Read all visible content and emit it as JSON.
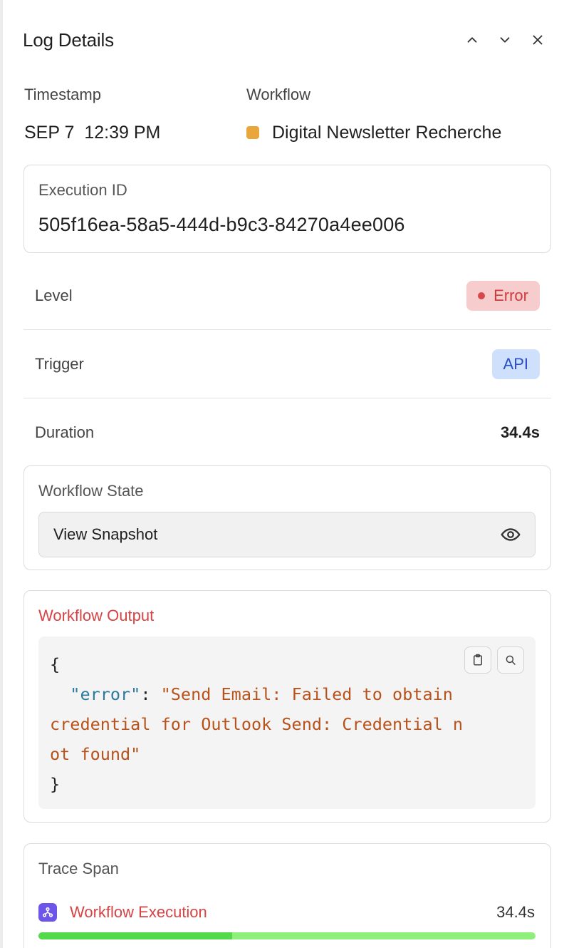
{
  "panel": {
    "title": "Log Details"
  },
  "meta": {
    "timestamp_label": "Timestamp",
    "timestamp_value": "SEP 7  12:39 PM",
    "workflow_label": "Workflow",
    "workflow_value": "Digital Newsletter Recherche",
    "workflow_color": "#e9a63b"
  },
  "execution": {
    "label": "Execution ID",
    "id": "505f16ea-58a5-444d-b9c3-84270a4ee006"
  },
  "level": {
    "label": "Level",
    "value": "Error"
  },
  "trigger": {
    "label": "Trigger",
    "value": "API"
  },
  "duration": {
    "label": "Duration",
    "value": "34.4s"
  },
  "workflow_state": {
    "label": "Workflow State",
    "button_label": "View Snapshot"
  },
  "output": {
    "label": "Workflow Output",
    "open_brace": "{",
    "key": "\"error\"",
    "colon": ": ",
    "value_line1": "\"Send Email: Failed to obtain",
    "value_line2": "credential for Outlook Send: Credential n",
    "value_line3": "ot found\"",
    "close_brace": "}"
  },
  "trace": {
    "label": "Trace Span",
    "span_name": "Workflow Execution",
    "span_duration": "34.4s",
    "progress": 0.39
  },
  "colors": {
    "error": "#d84343",
    "api": "#2a4fc4",
    "accent_purple": "#6c55e8",
    "progress_dark": "#53d94a",
    "progress_light": "#8ef07a"
  }
}
